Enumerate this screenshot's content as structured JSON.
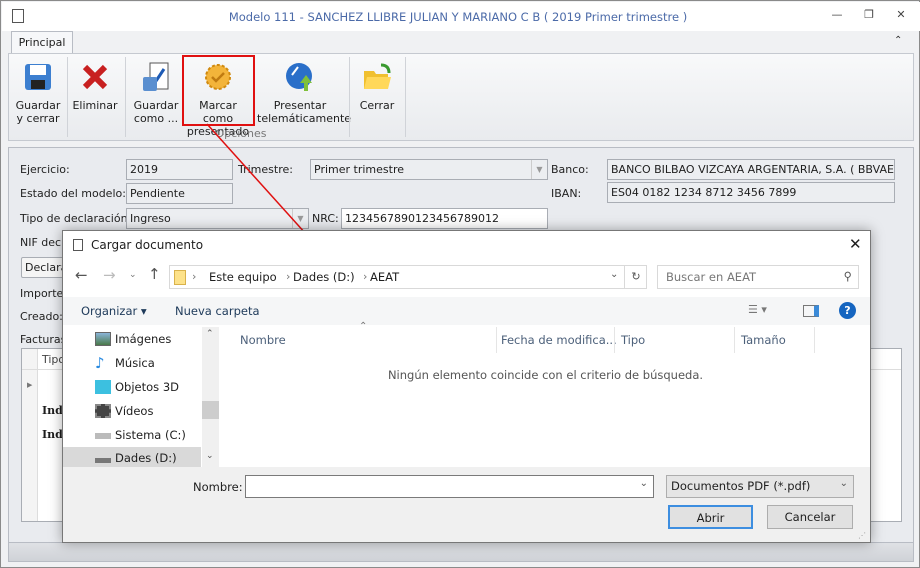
{
  "window": {
    "title": "Modelo 111 - SANCHEZ LLIBRE JULIAN Y MARIANO C B ( 2019 Primer trimestre )"
  },
  "ribbon": {
    "tab": "Principal",
    "group_label": "Opciones",
    "buttons": [
      {
        "l1": "Guardar",
        "l2": "y cerrar"
      },
      {
        "l1": "Eliminar",
        "l2": ""
      },
      {
        "l1": "Guardar",
        "l2": "como ..."
      },
      {
        "l1": "Marcar como",
        "l2": "presentado"
      },
      {
        "l1": "Presentar",
        "l2": "telemáticamente"
      },
      {
        "l1": "Cerrar",
        "l2": ""
      }
    ]
  },
  "form": {
    "ejercicio_label": "Ejercicio:",
    "ejercicio": "2019",
    "trimestre_label": "Trimestre:",
    "trimestre": "Primer trimestre",
    "banco_label": "Banco:",
    "banco": "BANCO BILBAO VIZCAYA ARGENTARIA, S.A. ( BBVAESMMXXX )",
    "estado_label": "Estado del modelo:",
    "estado": "Pendiente",
    "iban_label": "IBAN:",
    "iban": "ES04 0182 1234 8712 3456 7899",
    "tipo_label": "Tipo de declaración:",
    "tipo": "Ingreso",
    "nrc_label": "NRC:",
    "nrc": "1234567890123456789012",
    "nif_label": "NIF decla",
    "declarar_button": "Declarar",
    "importe_label": "Importe",
    "creado_label": "Creado:",
    "facturas_label": "Facturas",
    "grid": {
      "col_tipo": "Tipo",
      "rows": [
        "Indu",
        "Indu"
      ]
    }
  },
  "dialog": {
    "title": "Cargar documento",
    "path": [
      "Este equipo",
      "Dades (D:)",
      "AEAT"
    ],
    "search_placeholder": "Buscar en AEAT",
    "organizar": "Organizar",
    "nueva_carpeta": "Nueva carpeta",
    "nav_items": [
      "Imágenes",
      "Música",
      "Objetos 3D",
      "Vídeos",
      "Sistema (C:)",
      "Dades (D:)"
    ],
    "selected_nav": "Dades (D:)",
    "columns": [
      "Nombre",
      "Fecha de modifica...",
      "Tipo",
      "Tamaño"
    ],
    "empty_message": "Ningún elemento coincide con el criterio de búsqueda.",
    "filename_label": "Nombre:",
    "filename": "",
    "filter": "Documentos PDF (*.pdf)",
    "open_button": "Abrir",
    "cancel_button": "Cancelar"
  },
  "colors": {
    "highlight": "#e01010",
    "title_text": "#4b6aa8",
    "help_icon": "#1565c0"
  }
}
